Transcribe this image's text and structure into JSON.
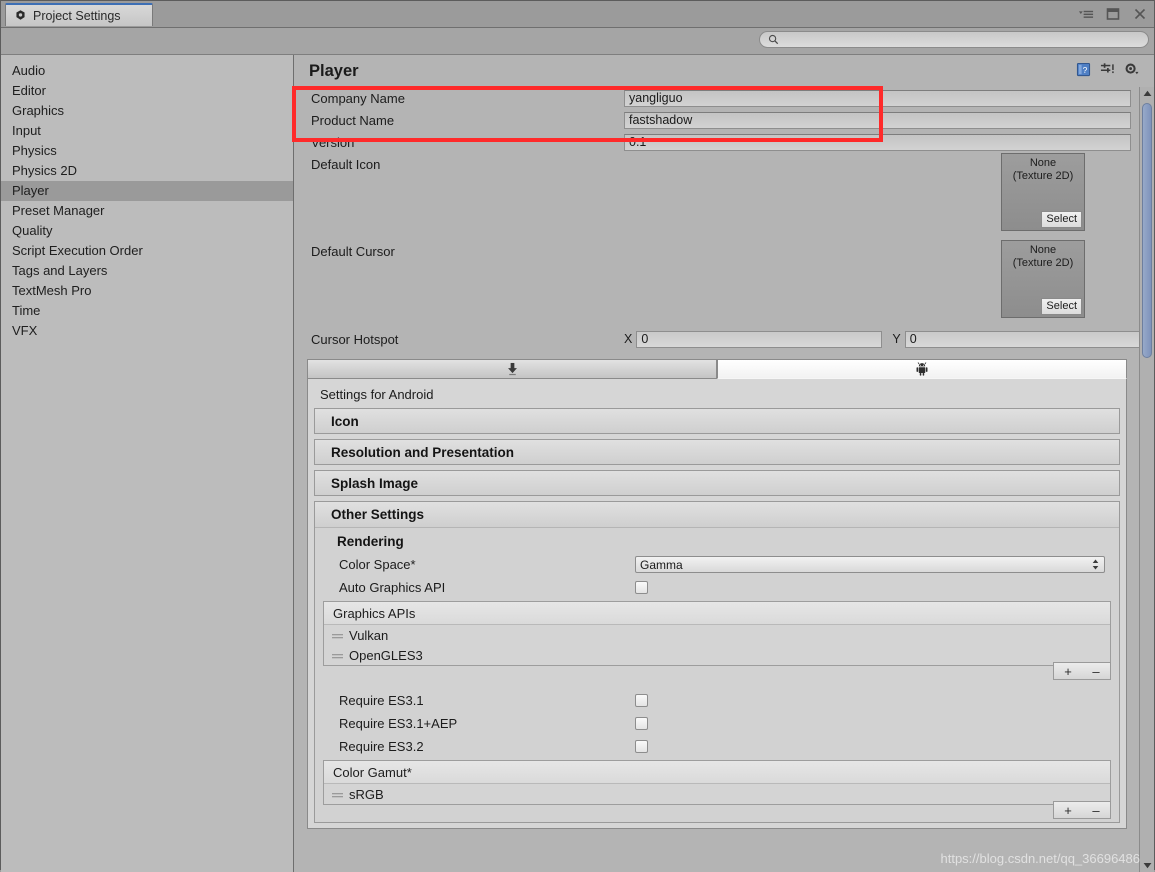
{
  "window": {
    "tab_label": "Project Settings",
    "tab_icon": "unity-gear-icon",
    "controls": [
      {
        "name": "menu-dropdown-icon",
        "label": "▾≡"
      },
      {
        "name": "maximize-icon",
        "label": "□"
      },
      {
        "name": "close-icon",
        "label": "✕"
      }
    ]
  },
  "search": {
    "value": "",
    "placeholder": "",
    "icon": "search-icon"
  },
  "sidebar": {
    "items": [
      {
        "label": "Audio",
        "selected": false
      },
      {
        "label": "Editor",
        "selected": false
      },
      {
        "label": "Graphics",
        "selected": false
      },
      {
        "label": "Input",
        "selected": false
      },
      {
        "label": "Physics",
        "selected": false
      },
      {
        "label": "Physics 2D",
        "selected": false
      },
      {
        "label": "Player",
        "selected": true
      },
      {
        "label": "Preset Manager",
        "selected": false
      },
      {
        "label": "Quality",
        "selected": false
      },
      {
        "label": "Script Execution Order",
        "selected": false
      },
      {
        "label": "Tags and Layers",
        "selected": false
      },
      {
        "label": "TextMesh Pro",
        "selected": false
      },
      {
        "label": "Time",
        "selected": false
      },
      {
        "label": "VFX",
        "selected": false
      }
    ]
  },
  "main": {
    "title": "Player",
    "header_icons": [
      {
        "name": "help-book-icon"
      },
      {
        "name": "preset-sliders-icon"
      },
      {
        "name": "settings-gear-icon"
      }
    ],
    "properties": [
      {
        "label": "Company Name",
        "value": "yangliguo"
      },
      {
        "label": "Product Name",
        "value": "fastshadow"
      },
      {
        "label": "Version",
        "value": "0.1"
      }
    ],
    "object_fields": [
      {
        "label": "Default Icon",
        "value": "None",
        "type": "(Texture 2D)",
        "select": "Select"
      },
      {
        "label": "Default Cursor",
        "value": "None",
        "type": "(Texture 2D)",
        "select": "Select"
      }
    ],
    "cursor_hotspot": {
      "label": "Cursor Hotspot",
      "x_label": "X",
      "x_value": "0",
      "y_label": "Y",
      "y_value": "0"
    },
    "platform_tabs": [
      {
        "icon": "standalone-download-icon",
        "active": false
      },
      {
        "icon": "android-robot-icon",
        "active": true
      }
    ],
    "settings_for": "Settings for Android",
    "collapsed_sections": [
      {
        "label": "Icon"
      },
      {
        "label": "Resolution and Presentation"
      },
      {
        "label": "Splash Image"
      }
    ],
    "other_settings": {
      "title": "Other Settings",
      "rendering_title": "Rendering",
      "color_space": {
        "label": "Color Space*",
        "value": "Gamma"
      },
      "auto_graphics_api": {
        "label": "Auto Graphics API",
        "checked": false
      },
      "graphics_apis": {
        "title": "Graphics APIs",
        "items": [
          "Vulkan",
          "OpenGLES3"
        ],
        "add_label": "+",
        "remove_label": "–"
      },
      "requirements": [
        {
          "label": "Require ES3.1",
          "checked": false
        },
        {
          "label": "Require ES3.1+AEP",
          "checked": false
        },
        {
          "label": "Require ES3.2",
          "checked": false
        }
      ],
      "color_gamut": {
        "title": "Color Gamut*",
        "items": [
          "sRGB"
        ],
        "add_label": "+",
        "remove_label": "–"
      }
    }
  },
  "annotation": {
    "color": "#ff2a2a"
  },
  "watermark": "https://blog.csdn.net/qq_36696486"
}
